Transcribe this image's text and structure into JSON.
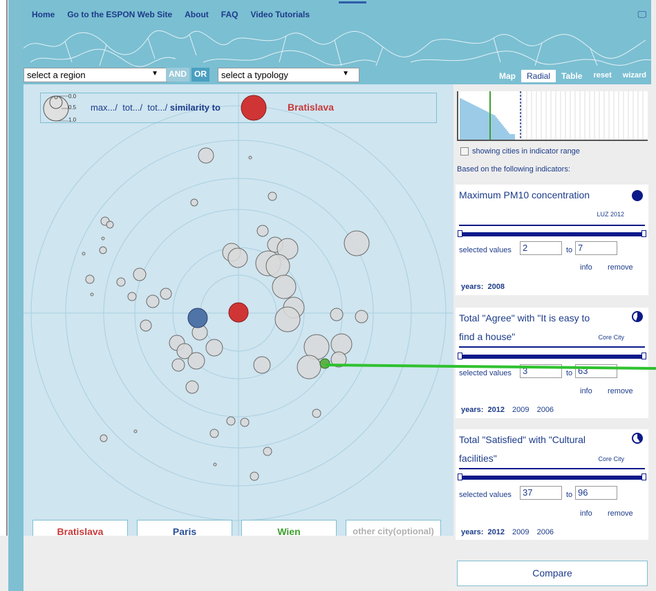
{
  "nav": {
    "links": [
      "Home",
      "Go to the ESPON Web Site",
      "About",
      "FAQ",
      "Video Tutorials"
    ],
    "tv_icon": "tv-icon"
  },
  "controls": {
    "region_select": "select a region",
    "and_label": "AND",
    "or_label": "OR",
    "typology_select": "select a typology",
    "view_tabs": {
      "map": "Map",
      "radial": "Radial",
      "table": "Table",
      "reset": "reset",
      "wizard": "wizard"
    }
  },
  "radial": {
    "legend": {
      "scale_labels": [
        "0.0",
        "0.5",
        "1.0"
      ],
      "trail_1": "max.../",
      "trail_2": "tot.../",
      "trail_3": "tot.../",
      "trail_4": "similarity to",
      "city": "Bratislava"
    },
    "city_buttons": [
      {
        "label": "Bratislava",
        "color": "#c8393a"
      },
      {
        "label": "Paris",
        "color": "#2a4f9a"
      },
      {
        "label": "Wien",
        "color": "#3fa12f"
      },
      {
        "label": "other city(optional)",
        "color": "#b0b0b0"
      }
    ]
  },
  "sidebar": {
    "checkbox_label": "showing cities in indicator range",
    "based_on": "Based on the following indicators:",
    "indicators": [
      {
        "title_1": "Maximum PM10 concentration",
        "title_2": "",
        "source": "LUZ 2012",
        "selected_label": "selected values",
        "from": "2",
        "to_label": "to",
        "to": "7",
        "info": "info",
        "remove": "remove",
        "years_label": "years:",
        "years": [
          "2008"
        ]
      },
      {
        "title_1": "Total \"Agree\" with \"It is easy to",
        "title_2": "find a house\"",
        "source": "Core City",
        "selected_label": "selected values",
        "from": "3",
        "to_label": "to",
        "to": "63",
        "info": "info",
        "remove": "remove",
        "years_label": "years:",
        "years": [
          "2012",
          "2009",
          "2006"
        ]
      },
      {
        "title_1": "Total \"Satisfied\" with \"Cultural",
        "title_2": "facilities\"",
        "source": "Core City",
        "selected_label": "selected values",
        "from": "37",
        "to_label": "to",
        "to": "96",
        "info": "info",
        "remove": "remove",
        "years_label": "years:",
        "years": [
          "2012",
          "2009",
          "2006"
        ]
      }
    ],
    "compare": "Compare"
  }
}
